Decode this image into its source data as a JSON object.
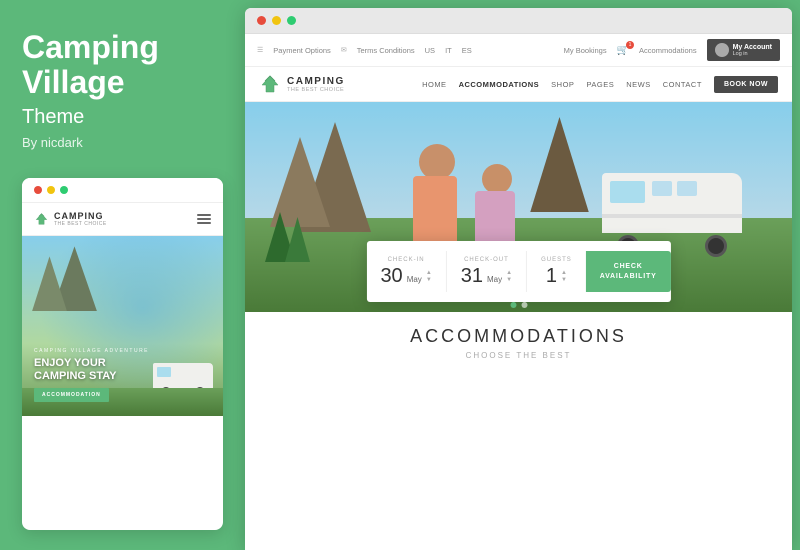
{
  "left_panel": {
    "title_line1": "Camping",
    "title_line2": "Village",
    "theme_label": "Theme",
    "by_label": "By nicdark",
    "mobile_preview": {
      "brand": "CAMPING",
      "tagline": "THE BEST CHOICE",
      "hero_subtitle": "CAMPING VILLAGE ADVENTURE",
      "hero_title": "ENJOY YOUR\nCAMPING STAY",
      "cta_label": "ACCOMMODATION"
    }
  },
  "browser": {
    "top_bar": {
      "payment_options": "Payment Options",
      "terms_conditions": "Terms Conditions",
      "lang_us": "US",
      "lang_it": "IT",
      "lang_es": "ES",
      "my_bookings": "My Bookings",
      "accommodations": "Accommodations",
      "account_label": "My Account",
      "account_sub": "Log in"
    },
    "nav": {
      "brand": "CAMPING",
      "tagline": "THE BEST CHOICE",
      "items": [
        "HOME",
        "ACCOMMODATIONS",
        "SHOP",
        "PAGES",
        "NEWS",
        "CONTACT"
      ],
      "book_now": "BOOK NOW"
    },
    "booking_bar": {
      "checkin_label": "CHECK-IN",
      "checkin_day": "30",
      "checkin_month": "May",
      "checkout_label": "CHECK-OUT",
      "checkout_day": "31",
      "checkout_month": "May",
      "guests_label": "GUESTS",
      "guests_value": "1",
      "check_avail_label": "CHECK\nAVAILABILITY"
    },
    "accommodations": {
      "title": "ACCOMMODATIONS",
      "subtitle": "CHOOSE THE BEST"
    }
  },
  "colors": {
    "green": "#5cb87a",
    "dark": "#4a4a4a",
    "text": "#333333",
    "light_text": "#888888",
    "border": "#eeeeee"
  }
}
